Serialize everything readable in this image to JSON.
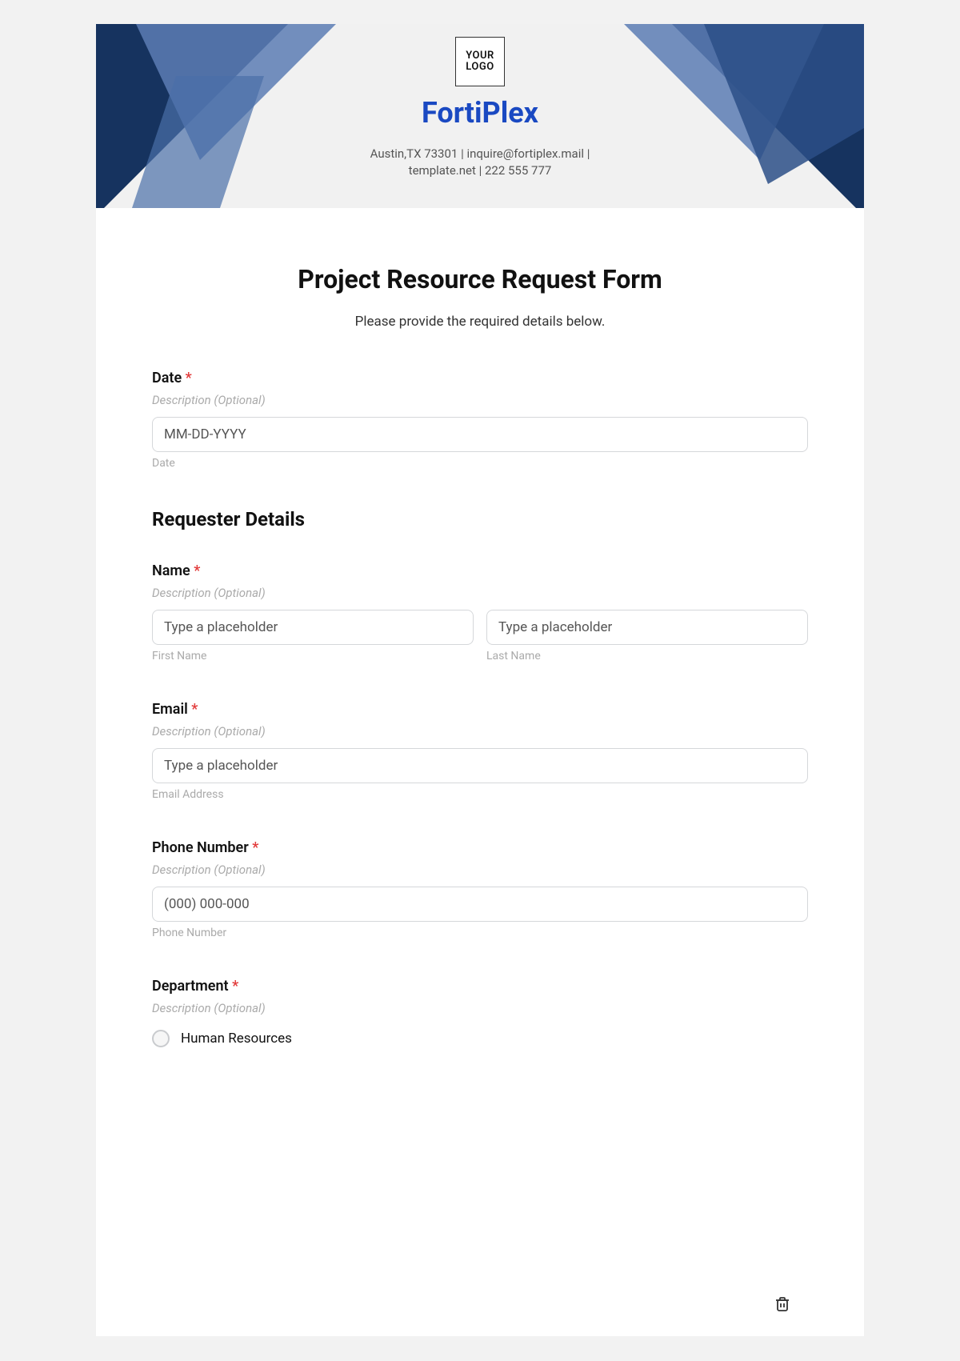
{
  "logo_text": "YOUR\nLOGO",
  "brand": "FortiPlex",
  "contact_line1": "Austin,TX 73301 | inquire@fortiplex.mail |",
  "contact_line2": "template.net | 222 555 777",
  "form_title": "Project Resource Request Form",
  "form_subtitle": "Please provide the required details below.",
  "desc_placeholder": "Description (Optional)",
  "fields": {
    "date": {
      "label": "Date",
      "placeholder": "MM-DD-YYYY",
      "sub": "Date"
    },
    "section_requester": "Requester Details",
    "name": {
      "label": "Name",
      "placeholder": "Type a placeholder",
      "sub_first": "First Name",
      "sub_last": "Last Name"
    },
    "email": {
      "label": "Email",
      "placeholder": "Type a placeholder",
      "sub": "Email Address"
    },
    "phone": {
      "label": "Phone Number",
      "placeholder": "(000) 000-000",
      "sub": "Phone Number"
    },
    "department": {
      "label": "Department",
      "option1": "Human Resources"
    }
  },
  "asterisk": "*"
}
